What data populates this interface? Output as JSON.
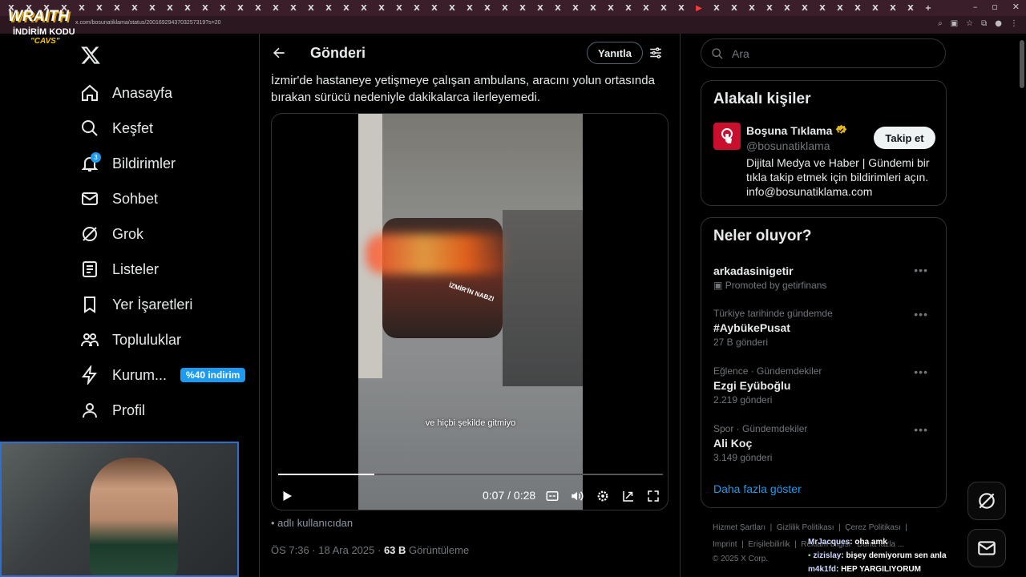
{
  "browser": {
    "url": "x.com/bosunatiklama/status/2001692943703257319?s=20",
    "tab_glyph": "X",
    "new_tab": "+"
  },
  "overlay": {
    "brand": "WRAITH",
    "code_label": "İNDİRİM KODU",
    "code": "\"CAVS\""
  },
  "nav": {
    "items": [
      {
        "label": "Anasayfa",
        "icon": "home-icon"
      },
      {
        "label": "Keşfet",
        "icon": "search-icon"
      },
      {
        "label": "Bildirimler",
        "icon": "bell-icon",
        "badge": "3"
      },
      {
        "label": "Sohbet",
        "icon": "mail-icon"
      },
      {
        "label": "Grok",
        "icon": "grok-icon"
      },
      {
        "label": "Listeler",
        "icon": "list-icon"
      },
      {
        "label": "Yer İşaretleri",
        "icon": "bookmark-icon"
      },
      {
        "label": "Topluluklar",
        "icon": "communities-icon"
      },
      {
        "label": "Kurum...",
        "icon": "lightning-icon",
        "pill": "%40 indirim"
      },
      {
        "label": "Profil",
        "icon": "profile-icon"
      }
    ]
  },
  "header": {
    "title": "Gönderi",
    "reply_label": "Yanıtla"
  },
  "tweet": {
    "text": "İzmir'de hastaneye yetişmeye çalışan ambulans, aracını yolun ortasında bırakan sürücü nedeniyle dakikalarca ilerleyemedi.",
    "video": {
      "watermark": "İZMİR'İN NABZI",
      "subtitle": "ve hiçbi şekilde gitmiyo",
      "current": "0:07",
      "duration": "0:28",
      "time_label": "0:07 / 0:28",
      "progress": 0.25
    },
    "attribution": "adlı kullanıcıdan",
    "timestamp": "ÖS 7:36 · 18 Ara 2025 ·",
    "views": "63 B",
    "views_label": "Görüntüleme"
  },
  "sidebar": {
    "search_placeholder": "Ara",
    "related_title": "Alakalı kişiler",
    "person": {
      "name": "Boşuna Tıklama",
      "handle": "@bosunatiklama",
      "bio": "Dijital Medya ve Haber | Gündemi bir tıkla takip etmek için bildirimleri açın. info@bosunatiklama.com",
      "follow_label": "Takip et"
    },
    "trends_title": "Neler oluyor?",
    "trends": [
      {
        "context": "",
        "title": "arkadasinigetir",
        "count": "Promoted by getirfinans"
      },
      {
        "context": "Türkiye tarihinde gündemde",
        "title": "#AybükePusat",
        "count": "27 B gönderi"
      },
      {
        "context": "Eğlence · Gündemdekiler",
        "title": "Ezgi Eyüboğlu",
        "count": "2.219 gönderi"
      },
      {
        "context": "Spor · Gündemdekiler",
        "title": "Ali Koç",
        "count": "3.149 gönderi"
      }
    ],
    "show_more": "Daha fazla göster",
    "footer": {
      "line1": [
        "Hizmet Şartları",
        "Gizlilik Politikası",
        "Çerez Politikası"
      ],
      "line2": [
        "Imprint",
        "Erişilebilirlik",
        "Reklam bilgisi",
        "Daha fazla ..."
      ],
      "copyright": "© 2025 X Corp."
    }
  },
  "stream_chat": [
    {
      "user": "MrJacques",
      "msg": ": oha amk"
    },
    {
      "user": "zizislay",
      "msg": ": bişey demiyorum sen anla"
    },
    {
      "user": "m4k1fd",
      "msg": ": HEP YARGILIYORUM"
    }
  ],
  "colors": {
    "accent": "#1d9bf0",
    "verified": "#e2b719",
    "bg": "#000000"
  }
}
